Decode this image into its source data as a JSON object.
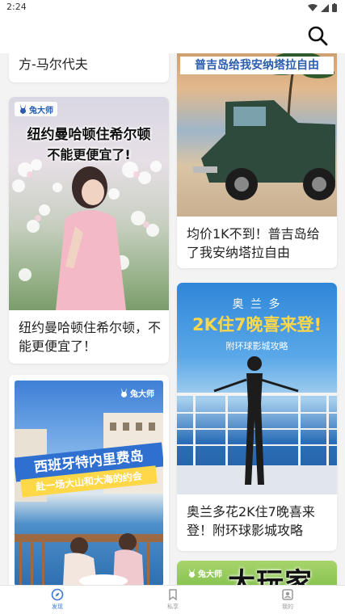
{
  "status": {
    "time": "2:24"
  },
  "header": {
    "search_icon": "search-icon"
  },
  "brand": {
    "badge": "兔大师"
  },
  "left_column": [
    {
      "title": "方-马尔代夫"
    },
    {
      "overlay_line1": "纽约曼哈顿住希尔顿",
      "overlay_line2": "不能更便宜了!",
      "title": "纽约曼哈顿住希尔顿，不能更便宜了！"
    },
    {
      "overlay_line1": "西班牙特内里费岛",
      "overlay_line2": "赴一场大山和大海的约会",
      "title": ""
    }
  ],
  "right_column": [
    {
      "overlay_line1": "普吉岛给我安纳塔拉自由",
      "title": "均价1K不到！普吉岛给了我安纳塔拉自由"
    },
    {
      "overlay_top": "奥 兰 多",
      "overlay_main": "2K住7晚喜来登!",
      "overlay_sub": "附环球影城攻略",
      "title": "奥兰多花2K住7晚喜来登！附环球影城攻略"
    }
  ],
  "tabbar": {
    "tabs": [
      {
        "label": "发现",
        "icon": "compass-icon",
        "active": true
      },
      {
        "label": "私享",
        "icon": "bookmark-icon",
        "active": false
      },
      {
        "label": "我的",
        "icon": "profile-icon",
        "active": false
      }
    ]
  },
  "watermark": "大玩家",
  "colors": {
    "accent": "#3a78d4",
    "highlight_yellow": "#ffd84a",
    "badge_blue": "#2a5db0"
  }
}
